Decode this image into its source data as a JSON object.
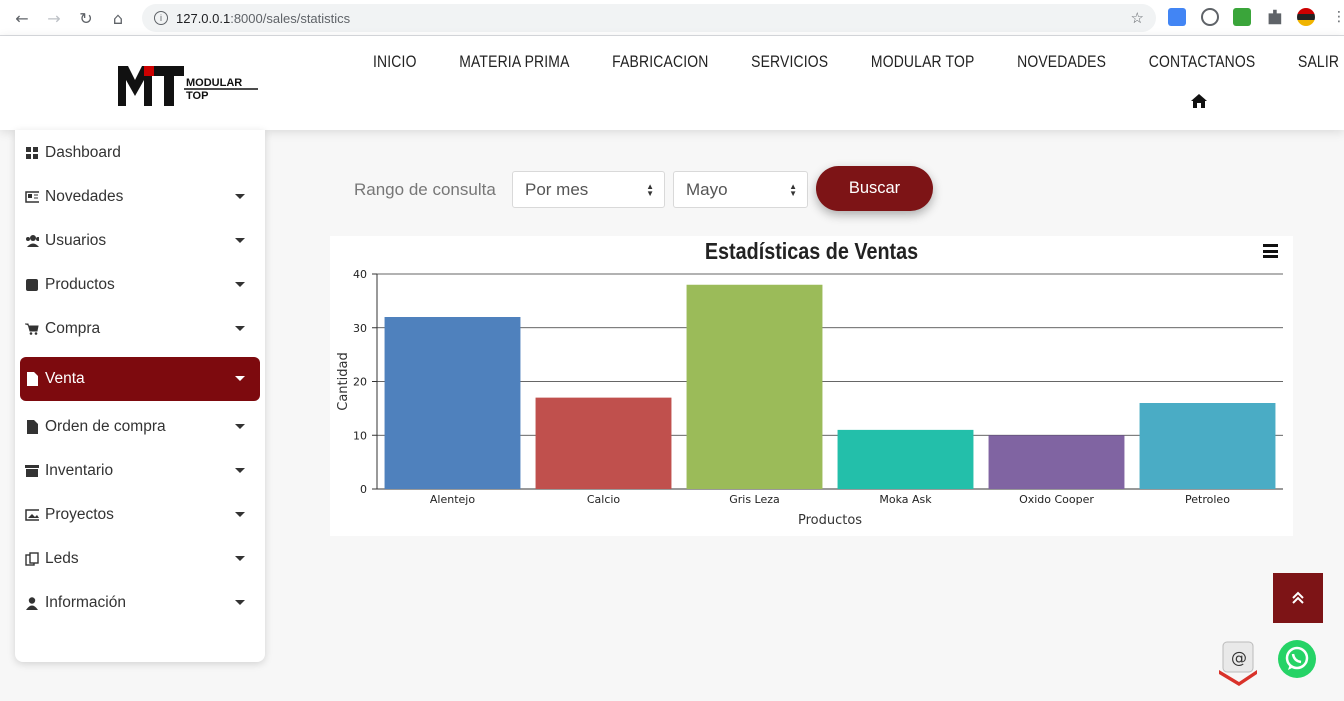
{
  "browser": {
    "url_host": "127.0.0.1",
    "url_rest": ":8000/sales/statistics"
  },
  "header": {
    "logo_big": "MT",
    "logo_text_1": "MODULAR",
    "logo_text_2": "TOP",
    "nav": [
      "INICIO",
      "MATERIA PRIMA",
      "FABRICACION",
      "SERVICIOS",
      "MODULAR TOP",
      "NOVEDADES",
      "CONTACTANOS",
      "SALIR"
    ]
  },
  "sidebar": {
    "items": [
      {
        "label": "Dashboard",
        "icon": "dashboard-icon",
        "caret": false
      },
      {
        "label": "Novedades",
        "icon": "newspaper-icon",
        "caret": true
      },
      {
        "label": "Usuarios",
        "icon": "users-icon",
        "caret": true
      },
      {
        "label": "Productos",
        "icon": "product-icon",
        "caret": true
      },
      {
        "label": "Compra",
        "icon": "cart-icon",
        "caret": true
      },
      {
        "label": "Venta",
        "icon": "file-icon",
        "caret": true,
        "active": true
      },
      {
        "label": "Orden de compra",
        "icon": "file-icon",
        "caret": true
      },
      {
        "label": "Inventario",
        "icon": "archive-icon",
        "caret": true
      },
      {
        "label": "Proyectos",
        "icon": "image-icon",
        "caret": true
      },
      {
        "label": "Leds",
        "icon": "copy-icon",
        "caret": true
      },
      {
        "label": "Información",
        "icon": "user-icon",
        "caret": true
      }
    ]
  },
  "filter": {
    "label": "Rango de consulta",
    "range_value": "Por mes",
    "month_value": "Mayo",
    "search_label": "Buscar"
  },
  "colors": {
    "accent": "#7d1416",
    "sidebar_active": "#7d0a0e"
  },
  "chart_data": {
    "type": "bar",
    "title": "Estadísticas de Ventas",
    "xlabel": "Productos",
    "ylabel": "Cantidad",
    "ylim": [
      0,
      40
    ],
    "yticks": [
      0,
      10,
      20,
      30,
      40
    ],
    "categories": [
      "Alentejo",
      "Calcio",
      "Gris Leza",
      "Moka Ask",
      "Oxido Cooper",
      "Petroleo"
    ],
    "values": [
      32,
      17,
      38,
      11,
      10,
      16
    ],
    "colors": [
      "#4f81bd",
      "#c0504d",
      "#9bbb59",
      "#23bfaa",
      "#8064a2",
      "#4aacc5"
    ],
    "grid": true
  }
}
